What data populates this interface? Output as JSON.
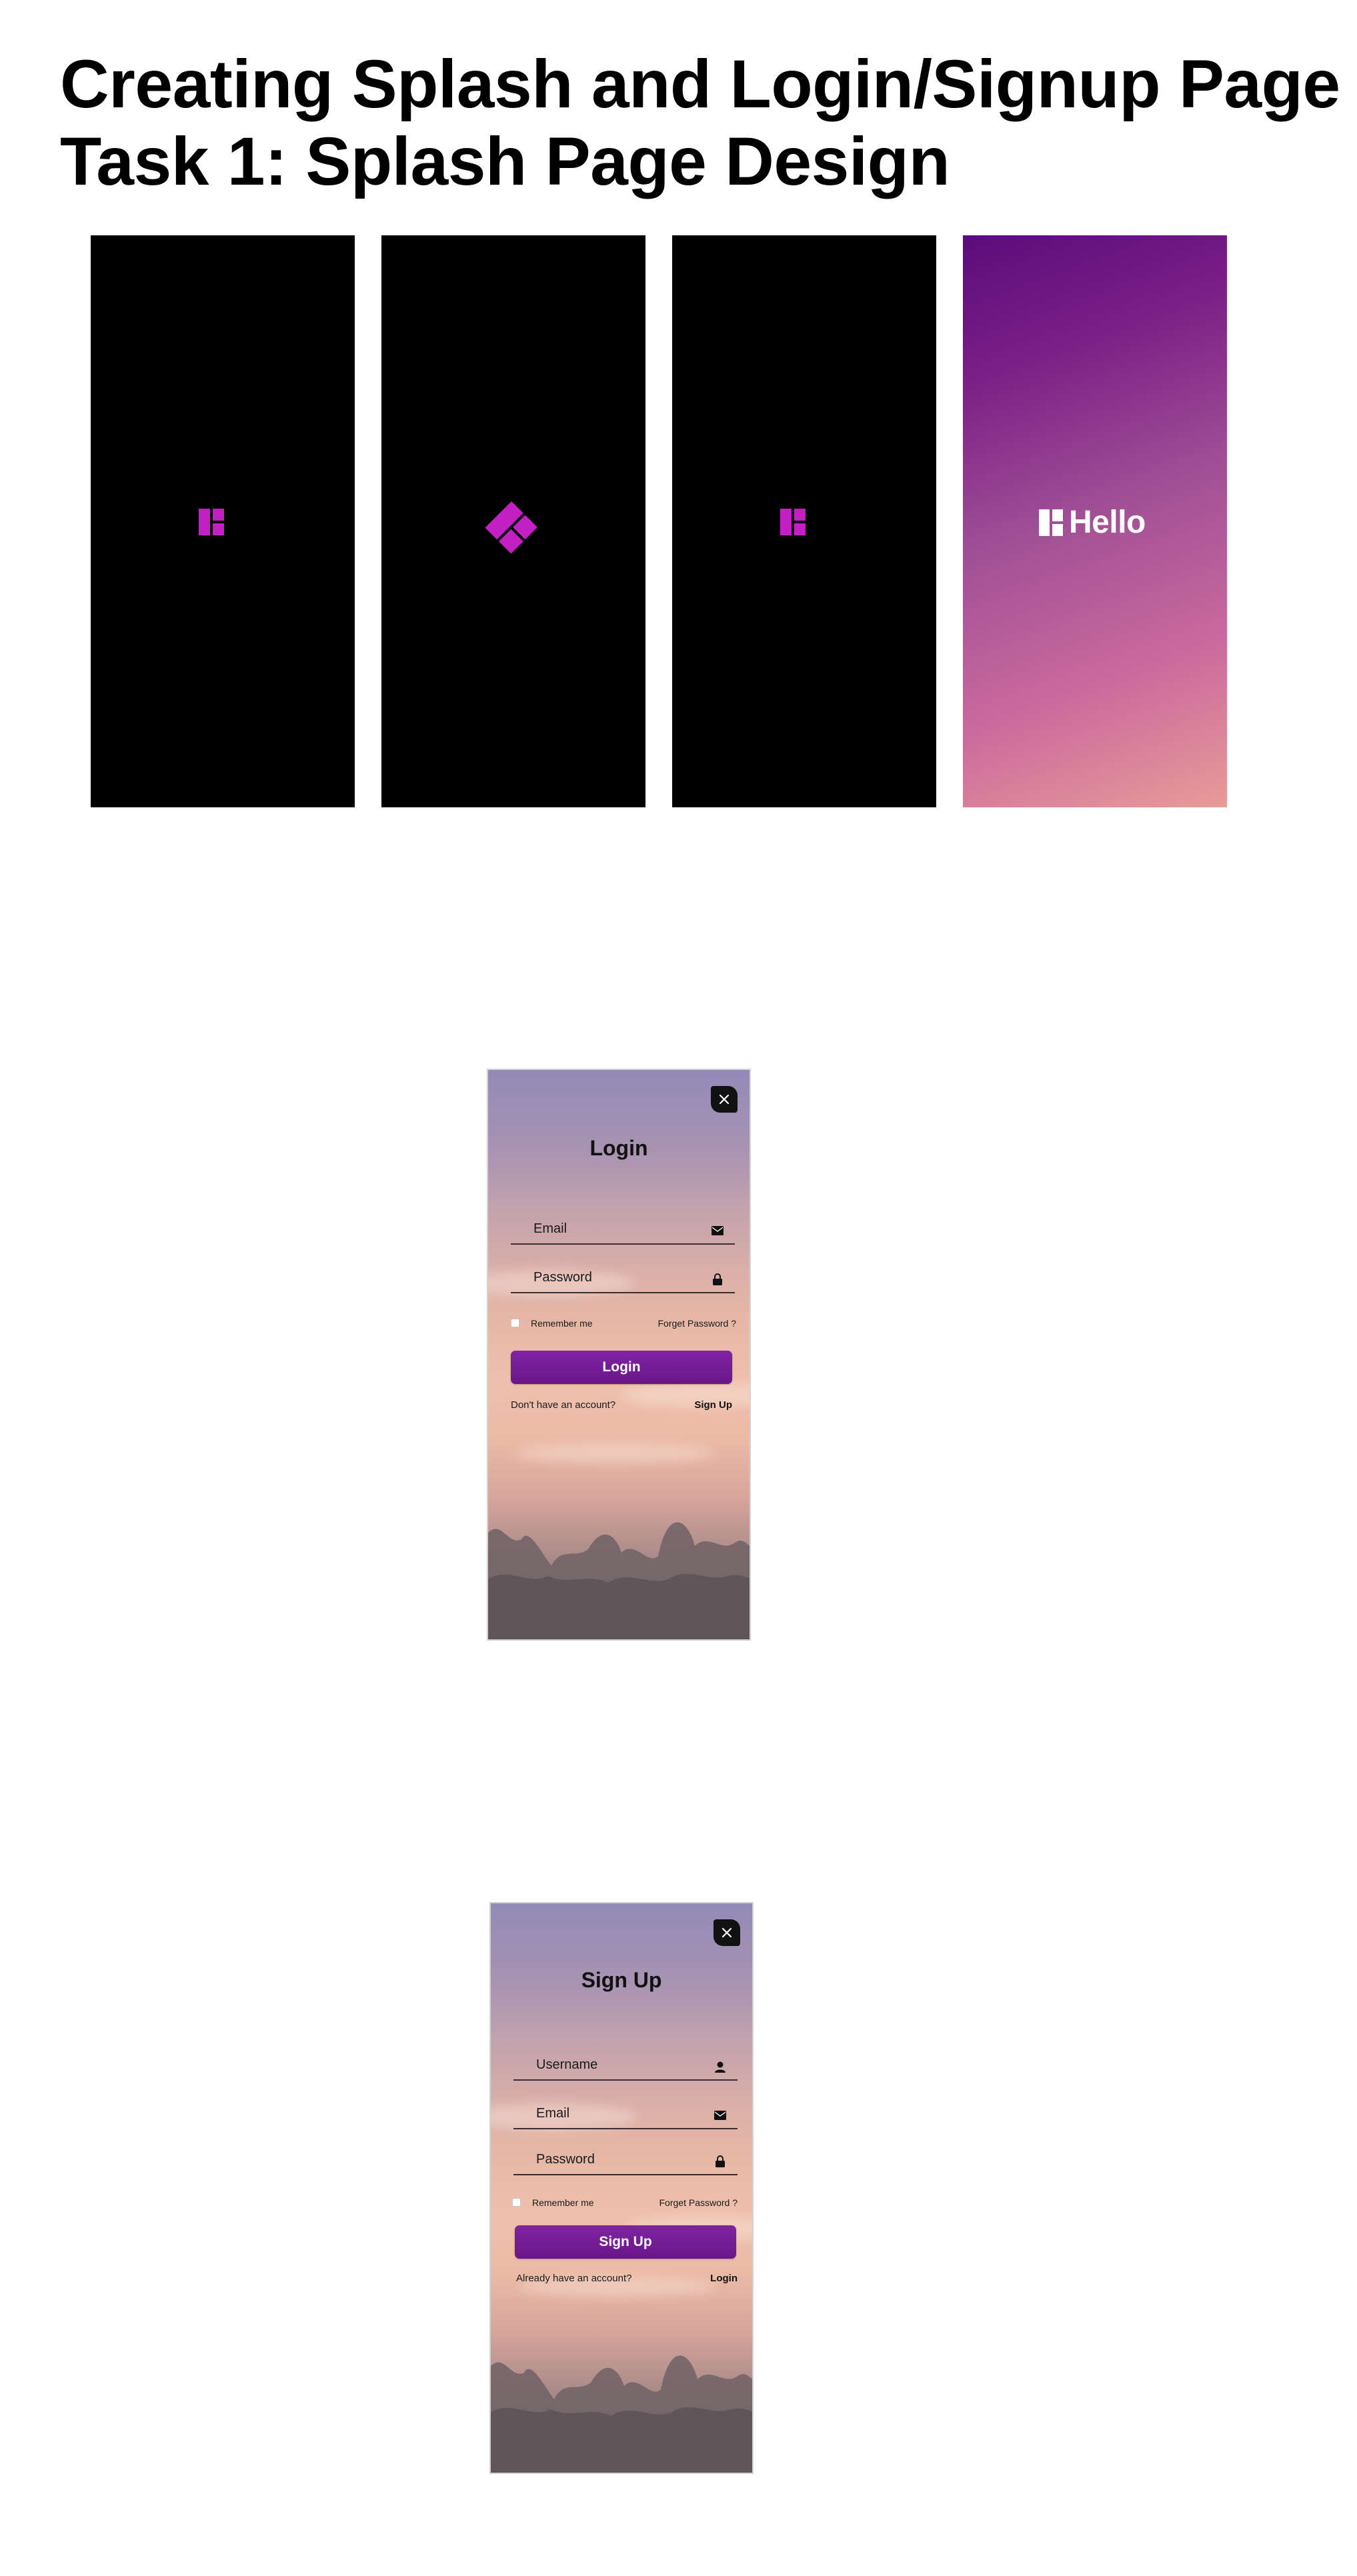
{
  "header": {
    "title": "Creating Splash and Login/Signup Page",
    "subtitle": "Task 1: Splash Page Design"
  },
  "colors": {
    "brand_magenta": "#c41fc4",
    "button_purple": "#7a1f9e",
    "gradient_top": "#5c0b7c",
    "gradient_bottom": "#e89b98"
  },
  "splash_screens": [
    {
      "icon": "grid-logo-icon"
    },
    {
      "icon": "diamond-logo-icon"
    },
    {
      "icon": "grid-logo-icon"
    },
    {
      "icon": "grid-logo-icon",
      "text": "Hello"
    }
  ],
  "login": {
    "title": "Login",
    "close_icon": "close-icon",
    "email_label": "Email",
    "email_icon": "envelope-icon",
    "password_label": "Password",
    "password_icon": "lock-icon",
    "remember_label": "Remember me",
    "forget_label": "Forget Password ?",
    "button_label": "Login",
    "prompt": "Don't have an account?",
    "switch_label": "Sign Up"
  },
  "signup": {
    "title": "Sign Up",
    "close_icon": "close-icon",
    "username_label": "Username",
    "username_icon": "user-icon",
    "email_label": "Email",
    "email_icon": "envelope-icon",
    "password_label": "Password",
    "password_icon": "lock-icon",
    "remember_label": "Remember me",
    "forget_label": "Forget Password ?",
    "button_label": "Sign Up",
    "prompt": "Already have an account?",
    "switch_label": "Login"
  }
}
